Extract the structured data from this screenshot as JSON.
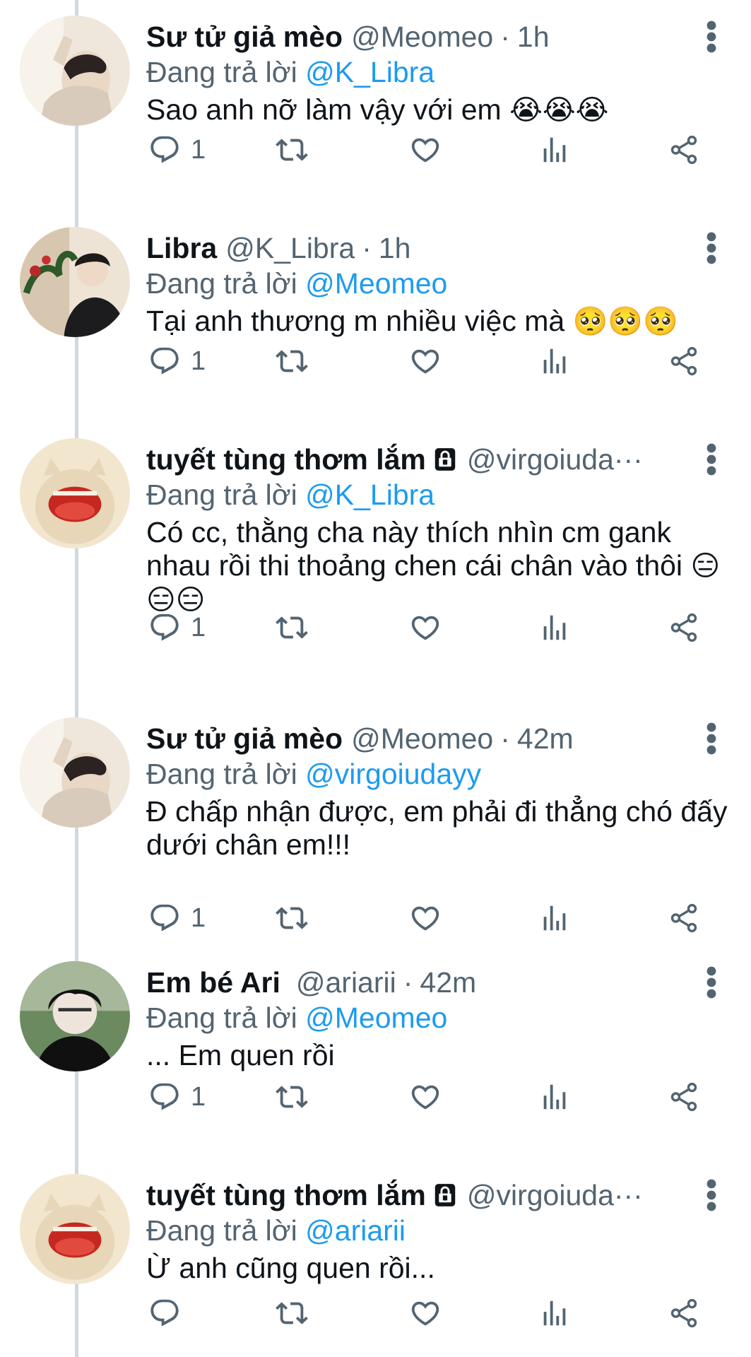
{
  "replying_prefix": "Đang trả lời",
  "colors": {
    "accent": "#1d9bf0",
    "secondary_text": "#536471",
    "thread_line": "#cfd9de"
  },
  "icons": [
    "more-icon",
    "reply-icon",
    "retweet-icon",
    "like-icon",
    "views-icon",
    "share-icon",
    "lock-icon"
  ],
  "tweets": [
    {
      "name": "Sư tử giả mèo",
      "handle": "@Meomeo",
      "sep": "·",
      "time": "1h",
      "replying_to": "@K_Libra",
      "text": "Sao anh nỡ làm vậy với em",
      "emoji": "😭😭😭",
      "reply_count": "1"
    },
    {
      "name": "Libra",
      "handle": "@K_Libra",
      "sep": "·",
      "time": "1h",
      "replying_to": "@Meomeo",
      "text": "Tại anh thương m nhiều việc mà",
      "emoji": "🥺🥺🥺",
      "reply_count": "1"
    },
    {
      "name": "tuyết tùng thơm lắm",
      "handle": "@virgoiuda···",
      "replying_to": "@K_Libra",
      "text": "Có cc, thằng cha này thích nhìn cm gank nhau rồi thi thoảng chen cái chân vào thôi",
      "emoji": "😑😑😑",
      "reply_count": "1"
    },
    {
      "name": "Sư tử giả mèo",
      "handle": "@Meomeo",
      "sep": "·",
      "time": "42m",
      "replying_to": "@virgoiudayy",
      "text": "Đ chấp nhận được, em phải đi thẳng chó đấy dưới chân em!!!",
      "emoji": "",
      "reply_count": "1"
    },
    {
      "name": "Em bé Ari",
      "handle": "@ariarii",
      "sep": "·",
      "time": "42m",
      "replying_to": "@Meomeo",
      "text": "... Em quen rồi",
      "emoji": "",
      "reply_count": "1"
    },
    {
      "name": "tuyết tùng thơm lắm",
      "handle": "@virgoiuda···",
      "replying_to": "@ariarii",
      "text": "Ừ anh cũng quen rồi...",
      "emoji": "",
      "reply_count": ""
    }
  ]
}
